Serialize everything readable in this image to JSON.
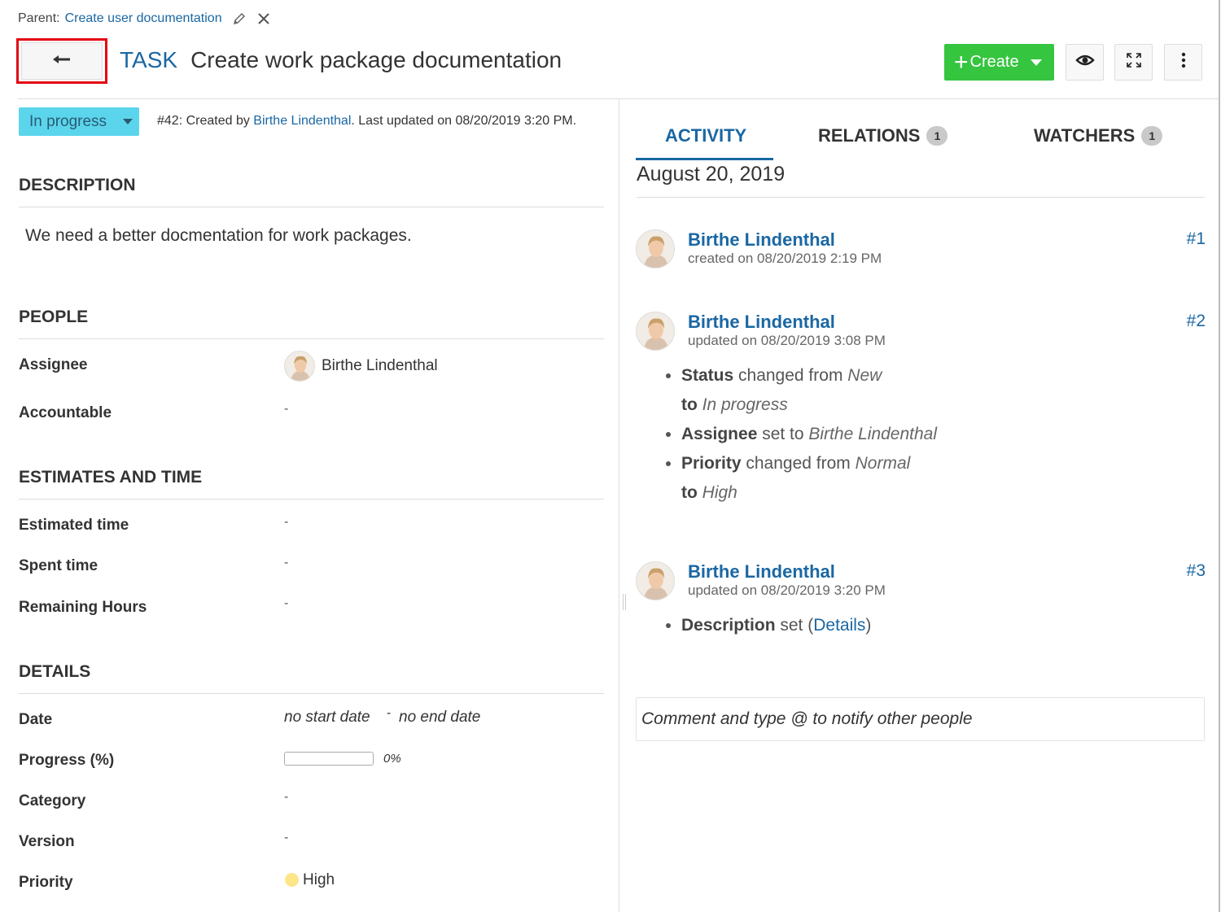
{
  "header": {
    "parent_label": "Parent:",
    "parent_link": "Create user documentation",
    "type": "TASK",
    "subject": "Create work package documentation",
    "create_label": "Create"
  },
  "status": {
    "label": "In progress",
    "meta_prefix": "#42: Created by ",
    "meta_author": "Birthe Lindenthal",
    "meta_suffix": ". Last updated on 08/20/2019 3:20 PM."
  },
  "sections": {
    "description": "DESCRIPTION",
    "people": "PEOPLE",
    "estimates": "ESTIMATES AND TIME",
    "details": "DETAILS"
  },
  "description_text": "We need a better docmentation for work packages.",
  "people": {
    "assignee_label": "Assignee",
    "assignee_value": "Birthe Lindenthal",
    "accountable_label": "Accountable",
    "accountable_value": "-"
  },
  "estimates": {
    "estimated_label": "Estimated time",
    "estimated_value": "-",
    "spent_label": "Spent time",
    "spent_value": "-",
    "remaining_label": "Remaining Hours",
    "remaining_value": "-"
  },
  "details": {
    "date_label": "Date",
    "start_date": "no start date",
    "date_sep": "-",
    "end_date": "no end date",
    "progress_label": "Progress (%)",
    "progress_value": "0%",
    "progress_fraction": 0,
    "category_label": "Category",
    "category_value": "-",
    "version_label": "Version",
    "version_value": "-",
    "priority_label": "Priority",
    "priority_value": "High",
    "priority_color": "#fde68a"
  },
  "tabs": [
    {
      "label": "ACTIVITY",
      "count": ""
    },
    {
      "label": "RELATIONS",
      "count": "1"
    },
    {
      "label": "WATCHERS",
      "count": "1"
    }
  ],
  "activity": {
    "date": "August 20, 2019",
    "entries": [
      {
        "author": "Birthe Lindenthal",
        "when": "created on 08/20/2019 2:19 PM",
        "num": "#1"
      },
      {
        "author": "Birthe Lindenthal",
        "when": "updated on 08/20/2019 3:08 PM",
        "num": "#2",
        "changes": [
          {
            "field": "Status",
            "verb": " changed from ",
            "from": "New",
            "to_word": "to ",
            "to": "In progress"
          },
          {
            "field": "Assignee",
            "verb": " set to ",
            "value": "Birthe Lindenthal"
          },
          {
            "field": "Priority",
            "verb": " changed from ",
            "from": "Normal",
            "to_word": "to ",
            "to": "High"
          }
        ]
      },
      {
        "author": "Birthe Lindenthal",
        "when": "updated on 08/20/2019 3:20 PM",
        "num": "#3",
        "changes": [
          {
            "field": "Description",
            "verb": " set (",
            "link": "Details",
            "close": ")"
          }
        ]
      }
    ],
    "comment_placeholder": "Comment and type @ to notify other people"
  },
  "colors": {
    "link": "#1a67a3",
    "create_button": "#35c53f",
    "status_button": "#5bd5ec",
    "highlight_border": "#e30613"
  },
  "icons": [
    "pencil-icon",
    "close-icon",
    "back-arrow-icon",
    "plus-icon",
    "caret-down-icon",
    "eye-icon",
    "fullscreen-icon",
    "more-vertical-icon"
  ]
}
